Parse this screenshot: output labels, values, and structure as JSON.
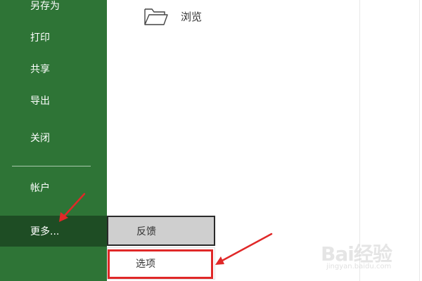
{
  "sidebar": {
    "items": [
      {
        "label": "另存为"
      },
      {
        "label": "打印"
      },
      {
        "label": "共享"
      },
      {
        "label": "导出"
      },
      {
        "label": "关闭"
      },
      {
        "label": "帐户"
      },
      {
        "label": "更多..."
      }
    ],
    "active_index": 6
  },
  "content": {
    "browse_label": "浏览"
  },
  "popup": {
    "items": [
      {
        "label": "反馈"
      },
      {
        "label": "选项"
      }
    ],
    "highlighted_index": 1
  },
  "watermark": {
    "brand": "Bai经验",
    "sub": "jingyan.baidu.com"
  },
  "colors": {
    "sidebar_bg": "#2e7436",
    "sidebar_active": "#1e4d24",
    "annotation_red": "#e02828"
  }
}
